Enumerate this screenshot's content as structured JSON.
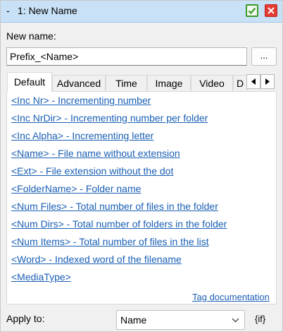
{
  "window": {
    "collapse_glyph": "-",
    "title": "1: New Name",
    "confirm_icon": "checkmark-icon",
    "close_icon": "close-icon",
    "confirm_color": "#3c9a2a",
    "close_color": "#e53b31"
  },
  "new_name": {
    "label": "New name:",
    "value": "Prefix_<Name>",
    "browse_label": "..."
  },
  "tabs": [
    {
      "label": "Default",
      "active": true
    },
    {
      "label": "Advanced",
      "active": false
    },
    {
      "label": "Time",
      "active": false
    },
    {
      "label": "Image",
      "active": false
    },
    {
      "label": "Video",
      "active": false
    },
    {
      "label": "D",
      "active": false
    }
  ],
  "tab_scroll": {
    "left_icon": "arrow-left-icon",
    "right_icon": "arrow-right-icon"
  },
  "tags": [
    "<Inc Nr> - Incrementing number",
    "<Inc NrDir> - Incrementing number per folder",
    "<Inc Alpha> - Incrementing letter",
    "<Name> - File name without extension",
    "<Ext> - File extension without the dot",
    "<FolderName> - Folder name",
    "<Num Files> - Total number of files in the folder",
    "<Num Dirs> - Total number of folders in the folder",
    "<Num Items> - Total number of files in the list",
    "<Word> - Indexed word of the filename",
    "<MediaType>"
  ],
  "tag_documentation": "Tag documentation",
  "apply_to": {
    "label": "Apply to:",
    "selected": "Name",
    "suffix": "{if}"
  },
  "link_color": "#1a5fb4"
}
